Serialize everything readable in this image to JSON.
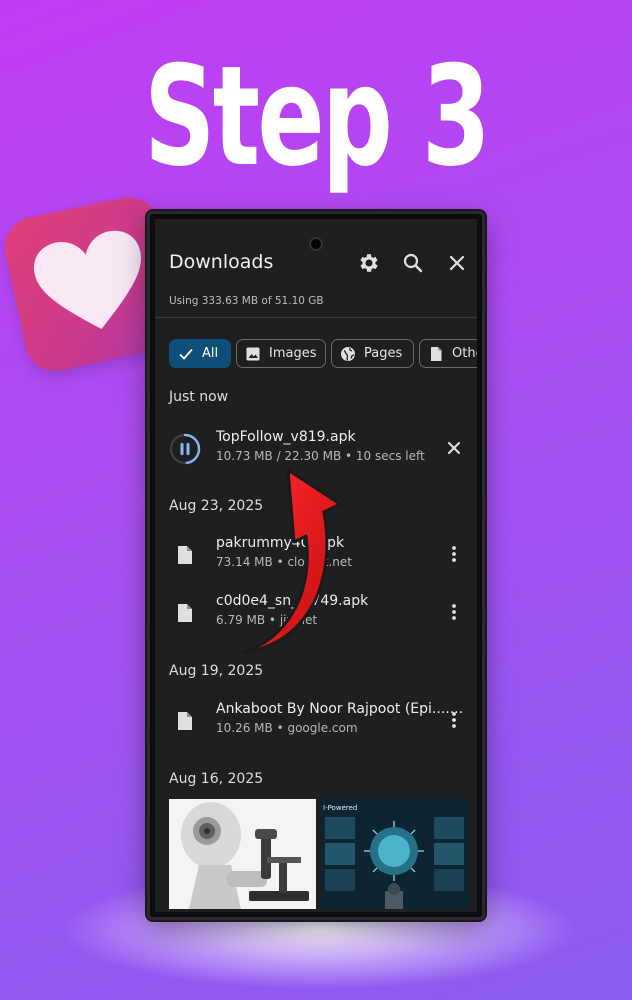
{
  "banner": {
    "title": "Step 3"
  },
  "app": {
    "title": "Downloads",
    "storage_text": "Using 333.63 MB of 51.10 GB",
    "icons": [
      "gear-icon",
      "search-icon",
      "close-icon"
    ]
  },
  "chips": [
    {
      "label": "All",
      "icon": "check-icon",
      "selected": true
    },
    {
      "label": "Images",
      "icon": "image-icon",
      "selected": false
    },
    {
      "label": "Pages",
      "icon": "globe-icon",
      "selected": false
    },
    {
      "label": "Othe",
      "icon": "document-icon",
      "selected": false
    }
  ],
  "sections": [
    {
      "header": "Just now",
      "items": [
        {
          "name": "TopFollow_v819.apk",
          "meta": "10.73 MB / 22.30 MB • 10 secs left",
          "state": "downloading",
          "icon": "pause-icon",
          "action_icon": "close-icon",
          "progress": 0.48
        }
      ]
    },
    {
      "header": "Aug 23, 2025",
      "items": [
        {
          "name": "pakrummy40 .apk",
          "meta": "73.14 MB • clou      nt.net",
          "icon": "file-icon",
          "action_icon": "more-vert-icon"
        },
        {
          "name": "c0d0e4_sn_     9749.apk",
          "meta": "6.79 MB • jjv      net",
          "icon": "file-icon",
          "action_icon": "more-vert-icon"
        }
      ]
    },
    {
      "header": "Aug 19, 2025",
      "items": [
        {
          "name": "Ankaboot By Noor Rajpoot (Epi.......",
          "meta": "10.26 MB • google.com",
          "icon": "file-icon",
          "action_icon": "more-vert-icon"
        }
      ]
    },
    {
      "header": "Aug 16, 2025",
      "thumbnails": [
        {
          "icon": "robot-microscope-image"
        },
        {
          "label": "I-Powered",
          "icon": "virus-dashboard-image"
        }
      ]
    }
  ],
  "colors": {
    "background_start": "#c03cf2",
    "background_end": "#8a5cf0",
    "screen_bg": "#1e1f20",
    "chip_selected": "#0e4e78",
    "progress_accent": "#8ab4f8",
    "arrow_red": "#e3171b",
    "heart_tile": "#e2407a"
  }
}
